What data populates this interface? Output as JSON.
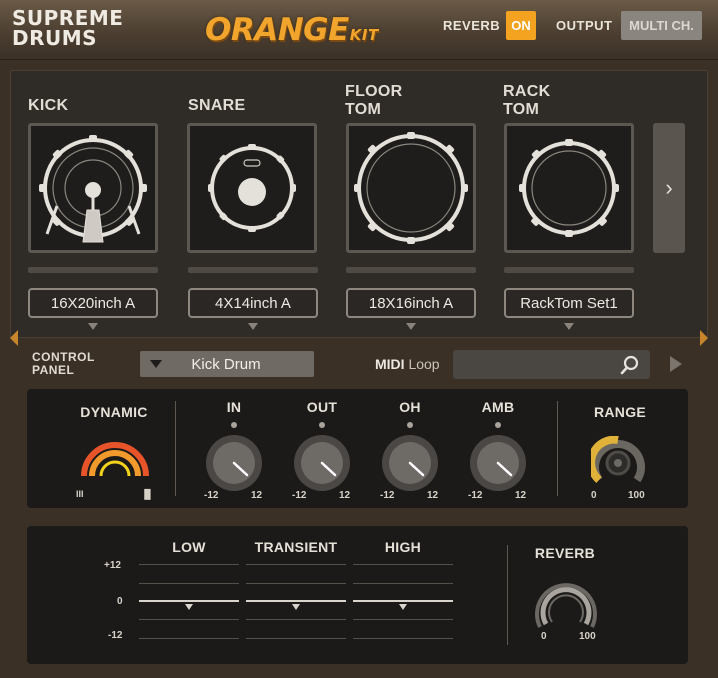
{
  "header": {
    "brand_line1": "SUPREME",
    "brand_line2": "DRUMS",
    "logo_main": "ORANGE",
    "logo_sub": "KIT",
    "reverb_label": "REVERB",
    "reverb_button": "ON",
    "output_label": "OUTPUT",
    "output_button": "MULTI CH."
  },
  "drums": [
    {
      "label_line1": "KICK",
      "label_line2": "",
      "preset": "16X20inch A",
      "icon": "kick-drum-icon"
    },
    {
      "label_line1": "SNARE",
      "label_line2": "",
      "preset": "4X14inch A",
      "icon": "snare-drum-icon"
    },
    {
      "label_line1": "FLOOR",
      "label_line2": "TOM",
      "preset": "18X16inch A",
      "icon": "floor-tom-icon"
    },
    {
      "label_line1": "RACK",
      "label_line2": "TOM",
      "preset": "RackTom Set1",
      "icon": "rack-tom-icon"
    }
  ],
  "next_icon": "chevron-right-icon",
  "control_panel": {
    "title_line1": "CONTROL",
    "title_line2": "PANEL",
    "selected": "Kick Drum",
    "midi_label_bold": "MIDI",
    "midi_label_rest": " Loop",
    "midi_value": "",
    "search_icon": "search-icon",
    "play_icon": "play-icon"
  },
  "dynamic": {
    "title": "DYNAMIC",
    "left_glyph": "III",
    "right_glyph": "▐▌",
    "colors": [
      "#e8542a",
      "#f39a2c",
      "#f3d21c"
    ]
  },
  "knobs": [
    {
      "title": "IN",
      "min": "-12",
      "max": "12",
      "value": 0.85
    },
    {
      "title": "OUT",
      "min": "-12",
      "max": "12",
      "value": 0.85
    },
    {
      "title": "OH",
      "min": "-12",
      "max": "12",
      "value": 0.85
    },
    {
      "title": "AMB",
      "min": "-12",
      "max": "12",
      "value": 0.85
    }
  ],
  "range": {
    "title": "RANGE",
    "min": "0",
    "max": "100",
    "value": 0.35,
    "accent": "#e0b23a"
  },
  "eq": {
    "scale_top": "+12",
    "scale_mid": "0",
    "scale_bottom": "-12",
    "bands": [
      "LOW",
      "TRANSIENT",
      "HIGH"
    ]
  },
  "reverb_knob": {
    "title": "REVERB",
    "min": "0",
    "max": "100",
    "value": 1.0
  }
}
